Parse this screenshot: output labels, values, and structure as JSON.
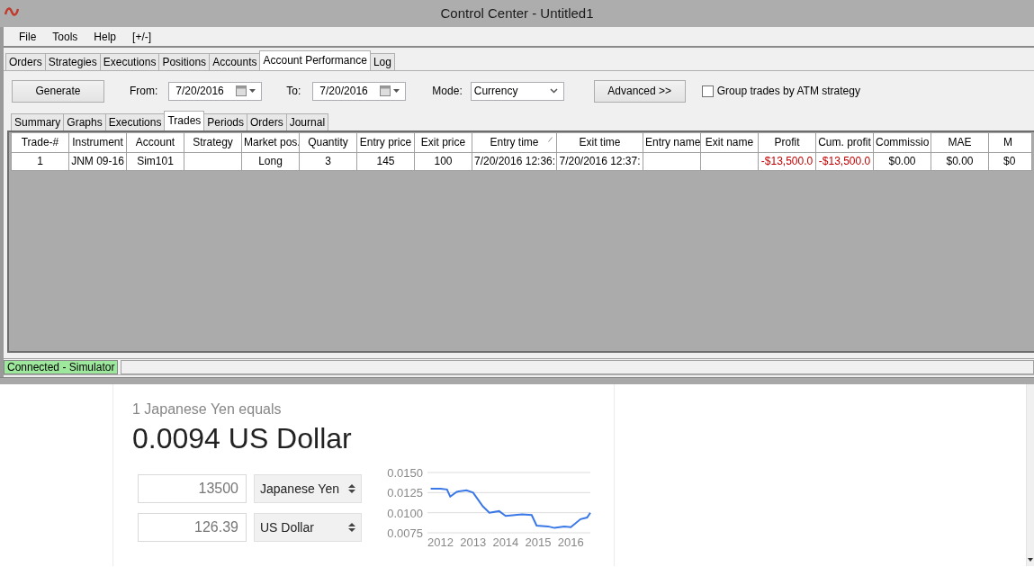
{
  "window": {
    "title": "Control Center - Untitled1"
  },
  "menu": [
    "File",
    "Tools",
    "Help",
    "[+/-]"
  ],
  "tabs": [
    {
      "label": "Orders",
      "selected": false
    },
    {
      "label": "Strategies",
      "selected": false
    },
    {
      "label": "Executions",
      "selected": false
    },
    {
      "label": "Positions",
      "selected": false
    },
    {
      "label": "Accounts",
      "selected": false
    },
    {
      "label": "Account Performance",
      "selected": true
    },
    {
      "label": "Log",
      "selected": false
    }
  ],
  "toolbar": {
    "generate_button": "Generate",
    "from_label": "From:",
    "from_date": "7/20/2016",
    "to_label": "To:",
    "to_date": "7/20/2016",
    "mode_label": "Mode:",
    "mode_value": "Currency",
    "advanced_button": "Advanced >>",
    "group_checkbox": {
      "label": "Group trades by ATM strategy",
      "checked": false
    }
  },
  "sub_tabs": [
    {
      "label": "Summary",
      "selected": false
    },
    {
      "label": "Graphs",
      "selected": false
    },
    {
      "label": "Executions",
      "selected": false
    },
    {
      "label": "Trades",
      "selected": true
    },
    {
      "label": "Periods",
      "selected": false
    },
    {
      "label": "Orders",
      "selected": false
    },
    {
      "label": "Journal",
      "selected": false
    }
  ],
  "table": {
    "columns": [
      {
        "label": "Trade-#",
        "sorted": false
      },
      {
        "label": "Instrument",
        "sorted": false
      },
      {
        "label": "Account",
        "sorted": false
      },
      {
        "label": "Strategy",
        "sorted": false
      },
      {
        "label": "Market pos.",
        "sorted": false
      },
      {
        "label": "Quantity",
        "sorted": false
      },
      {
        "label": "Entry price",
        "sorted": false
      },
      {
        "label": "Exit price",
        "sorted": false
      },
      {
        "label": "Entry time",
        "sorted": true
      },
      {
        "label": "Exit time",
        "sorted": false
      },
      {
        "label": "Entry name",
        "sorted": false
      },
      {
        "label": "Exit name",
        "sorted": false
      },
      {
        "label": "Profit",
        "sorted": false
      },
      {
        "label": "Cum. profit",
        "sorted": false
      },
      {
        "label": "Commissio",
        "sorted": false
      },
      {
        "label": "MAE",
        "sorted": false
      },
      {
        "label": "M",
        "sorted": false
      }
    ],
    "rows": [
      {
        "cells": [
          {
            "text": "1",
            "negative": false
          },
          {
            "text": "JNM 09-16",
            "negative": false
          },
          {
            "text": "Sim101",
            "negative": false
          },
          null,
          {
            "text": "Long",
            "negative": false
          },
          {
            "text": "3",
            "negative": false
          },
          {
            "text": "145",
            "negative": false
          },
          {
            "text": "100",
            "negative": false
          },
          {
            "text": "7/20/2016 12:36:",
            "negative": false
          },
          {
            "text": "7/20/2016 12:37:",
            "negative": false
          },
          null,
          null,
          {
            "text": "-$13,500.0",
            "negative": true
          },
          {
            "text": "-$13,500.0",
            "negative": true
          },
          {
            "text": "$0.00",
            "negative": false
          },
          {
            "text": "$0.00",
            "negative": false
          },
          {
            "text": "$0",
            "negative": false
          }
        ]
      }
    ]
  },
  "status_bar": {
    "connection": "Connected - Simulator",
    "connected": true
  },
  "converter": {
    "caption": "1 Japanese Yen equals",
    "result": "0.0094 US Dollar",
    "inputs": [
      {
        "value": "13500",
        "currency": "Japanese Yen"
      },
      {
        "value": "126.39",
        "currency": "US Dollar"
      }
    ],
    "chart_data": {
      "type": "line",
      "x": [
        2011.7,
        2012.0,
        2012.2,
        2012.3,
        2012.5,
        2012.8,
        2013.0,
        2013.3,
        2013.5,
        2013.8,
        2014.0,
        2014.5,
        2014.8,
        2014.95,
        2015.3,
        2015.5,
        2015.8,
        2016.0,
        2016.3,
        2016.5,
        2016.6
      ],
      "series": [
        {
          "color": "#3b78e7",
          "values": [
            0.013,
            0.013,
            0.0129,
            0.012,
            0.0126,
            0.0128,
            0.0125,
            0.0108,
            0.01,
            0.0102,
            0.0096,
            0.0098,
            0.0097,
            0.0084,
            0.0083,
            0.0081,
            0.0083,
            0.0082,
            0.0092,
            0.0094,
            0.01
          ]
        }
      ],
      "xlim": [
        2011.6,
        2016.6
      ],
      "ylim": [
        0.0075,
        0.015
      ],
      "grid": true,
      "xticks": [
        2012,
        2013,
        2014,
        2015,
        2016
      ],
      "yticks": [
        {
          "value": 0.015,
          "label": "0.0150"
        },
        {
          "value": 0.0125,
          "label": "0.0125"
        },
        {
          "value": 0.01,
          "label": "0.0100"
        },
        {
          "value": 0.0075,
          "label": "0.0075"
        }
      ]
    }
  }
}
